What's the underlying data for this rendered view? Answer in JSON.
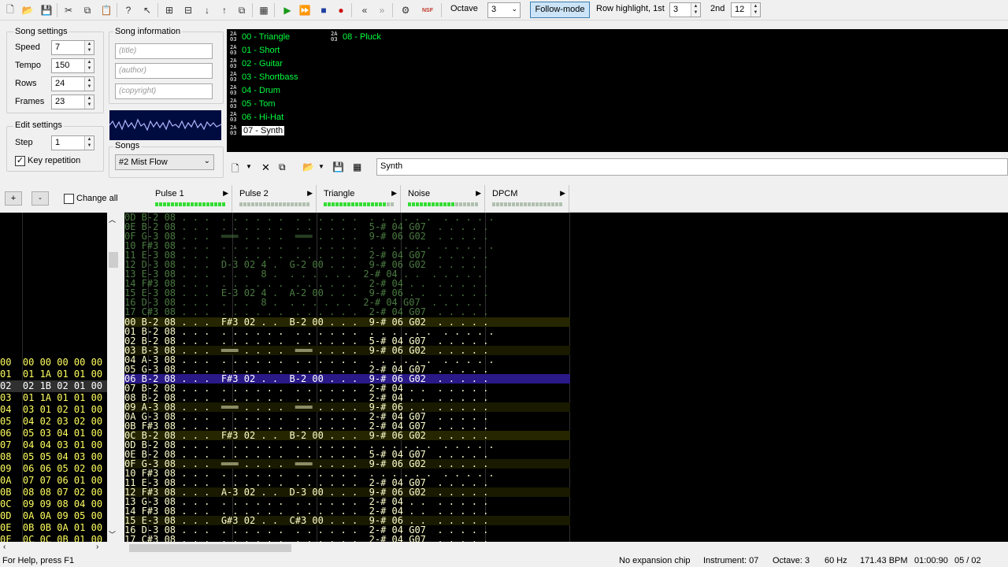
{
  "toolbar": {
    "octave_label": "Octave",
    "octave_value": "3",
    "follow_mode": "Follow-mode",
    "row_highlight_label": "Row highlight, 1st",
    "row_highlight_1": "3",
    "second_label": "2nd",
    "row_highlight_2": "12",
    "nsf_label": "NSF"
  },
  "song_settings": {
    "title": "Song settings",
    "speed_label": "Speed",
    "speed": "7",
    "tempo_label": "Tempo",
    "tempo": "150",
    "rows_label": "Rows",
    "rows": "24",
    "frames_label": "Frames",
    "frames": "23"
  },
  "song_information": {
    "title": "Song information",
    "title_placeholder": "(title)",
    "author_placeholder": "(author)",
    "copyright_placeholder": "(copyright)"
  },
  "edit_settings": {
    "title": "Edit settings",
    "step_label": "Step",
    "step": "1",
    "key_repetition": "Key repetition"
  },
  "songs": {
    "title": "Songs",
    "selected": "#2 Mist Flow"
  },
  "instruments": [
    {
      "num": "00",
      "name": "00 - Triangle"
    },
    {
      "num": "01",
      "name": "01 - Short"
    },
    {
      "num": "02",
      "name": "02 - Guitar"
    },
    {
      "num": "03",
      "name": "03 - Shortbass"
    },
    {
      "num": "04",
      "name": "04 - Drum"
    },
    {
      "num": "05",
      "name": "05 - Tom"
    },
    {
      "num": "06",
      "name": "06 - Hi-Hat"
    },
    {
      "num": "07",
      "name": "07 - Synth"
    },
    {
      "num": "08",
      "name": "08 - Pluck"
    }
  ],
  "instrument_icon_text": "2A\n03",
  "instrument_name_field": "Synth",
  "frame_controls": {
    "add": "+",
    "remove": "-",
    "change_all": "Change all"
  },
  "channels": [
    "Pulse 1",
    "Pulse 2",
    "Triangle",
    "Noise",
    "DPCM"
  ],
  "frames": [
    "00  00 00 00 00 00",
    "01  01 1A 01 01 00",
    "02  02 1B 02 01 00",
    "03  01 1A 01 01 00",
    "04  03 01 02 01 00",
    "05  04 02 03 02 00",
    "06  05 03 04 01 00",
    "07  04 04 03 01 00",
    "08  05 05 04 03 00",
    "09  06 06 05 02 00",
    "0A  07 07 06 01 00",
    "0B  08 08 07 02 00",
    "0C  09 09 08 04 00",
    "0D  0A 0A 09 05 00",
    "0E  0B 0B 0A 01 00",
    "0F  0C 0C 0B 01 00"
  ],
  "pattern_prev": [
    "0D B-2 08 . . .  . . . . . .  . . . . . .  . . . . . .  . . . . .",
    "0E B-2 08 . . .  . . . . . .  . . . . . .  5-# 04 G07  . . . . .",
    "0F G-3 08 . . .  ═══ . . . .  ═══ . . . .  9-# 06 G02  . . . . .",
    "10 F#3 08 . . .  . . . . . .  . . . . . .  . . . . . .  . . . . .",
    "11 E-3 08 . . .  . . . . . .  . . . . . .  2-# 04 G07  . . . . .",
    "12 D-3 08 . . .  D-3 02 4 .  G-2 00 . . .  9-# 06 G02  . . . . .",
    "13 E-3 08 . . .  . . .  8 .  . . . . . .  2-# 04 . .  . . . . .",
    "14 F#3 08 . . .  . . . . . .  . . . . . .  2-# 04 . .  . . . . .",
    "15 E-3 08 . . .  E-3 02 4 .  A-2 00 . . .  9-# 06 . .  . . . . .",
    "16 D-3 08 . . .  . . .  8 .  . . . . . .  2-# 04 G07  . . . . .",
    "17 C#3 08 . . .  . . . . . .  . . . . . .  2-# 04 G07  . . . . ."
  ],
  "pattern_cur": [
    "00 B-2 08 . . .  F#3 02 . .  B-2 00 . . .  9-# 06 G02  . . . . .",
    "01 B-2 08 . . .  . . . . . .  . . . . . .  . . . . . .  . . . . .",
    "02 B-2 08 . . .  . . . . . .  . . . . . .  5-# 04 G07  . . . . .",
    "03 B-3 08 . . .  ═══ . . . .  ═══ . . . .  9-# 06 G02  . . . . .",
    "04 A-3 08 . . .  . . . . . .  . . . . . .  . . . . . .  . . . . .",
    "05 G-3 08 . . .  . . . . . .  . . . . . .  2-# 04 G07  . . . . .",
    "06 B-2 08 . . .  F#3 02 . .  B-2 00 . . .  9-# 06 G02  . . . . .",
    "07 B-2 08 . . .  . . . . . .  . . . . . .  2-# 04 . .  . . . . .",
    "08 B-2 08 . . .  . . . . . .  . . . . . .  2-# 04 . .  . . . . .",
    "09 A-3 08 . . .  ═══ . . . .  ═══ . . . .  9-# 06 . .  . . . . .",
    "0A G-3 08 . . .  . . . . . .  . . . . . .  2-# 04 G07  . . . . .",
    "0B F#3 08 . . .  . . . . . .  . . . . . .  2-# 04 G07  . . . . .",
    "0C B-2 08 . . .  F#3 02 . .  B-2 00 . . .  9-# 06 G02  . . . . .",
    "0D B-2 08 . . .  . . . . . .  . . . . . .  . . . . . .  . . . . .",
    "0E B-2 08 . . .  . . . . . .  . . . . . .  5-# 04 G07  . . . . .",
    "0F G-3 08 . . .  ═══ . . . .  ═══ . . . .  9-# 06 G02  . . . . .",
    "10 F#3 08 . . .  . . . . . .  . . . . . .  . . . . . .  . . . . .",
    "11 E-3 08 . . .  . . . . . .  . . . . . .  2-# 04 G07  . . . . .",
    "12 F#3 08 . . .  A-3 02 . .  D-3 00 . . .  9-# 06 G02  . . . . .",
    "13 G-3 08 . . .  . . . . . .  . . . . . .  2-# 04 . .  . . . . .",
    "14 F#3 08 . . .  . . . . . .  . . . . . .  2-# 04 . .  . . . . .",
    "15 E-3 08 . . .  G#3 02 . .  C#3 00 . . .  9-# 06 . .  . . . . .",
    "16 D-3 08 . . .  . . . . . .  . . . . . .  2-# 04 G07  . . . . .",
    "17 C#3 08 . . .  . . . . . .  . . . . . .  2-# 04 G07  . . . . ."
  ],
  "status": {
    "help": "For Help, press F1",
    "expansion": "No expansion chip",
    "instrument": "Instrument: 07",
    "octave": "Octave: 3",
    "rate": "60 Hz",
    "bpm": "171.43 BPM",
    "time": "01:00:90",
    "position": "05 / 02"
  },
  "colors": {
    "bg": "#000000",
    "green_text": "#00ff40",
    "row_text": "#ffffcc",
    "highlight_row": "#1a1a00",
    "cursor_row": "#2a1a88",
    "dim_text": "#606040"
  }
}
